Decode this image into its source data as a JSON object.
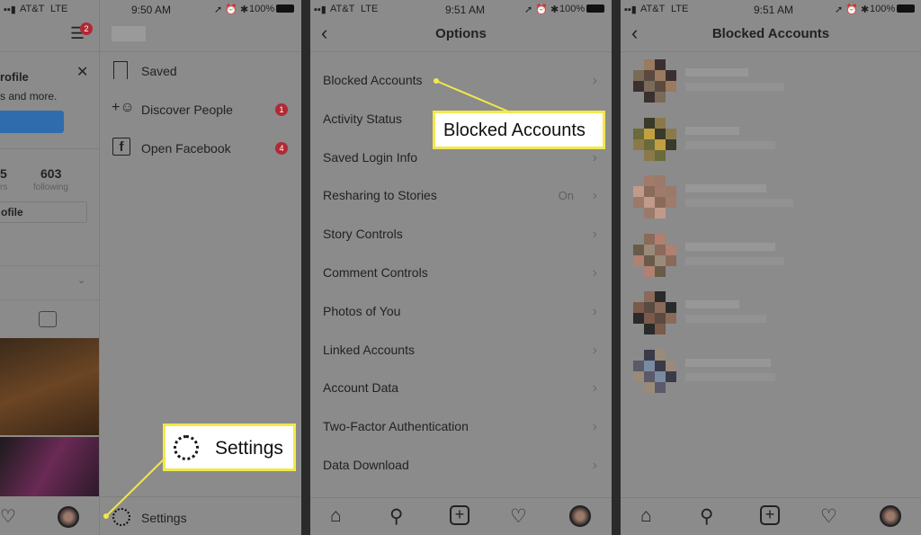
{
  "panel1": {
    "status": {
      "carrier": "AT&T",
      "network": "LTE",
      "time": "9:50 AM",
      "battery": "100%"
    },
    "menu_badge": "2",
    "profile_banner": {
      "title_fragment": "rofile",
      "text_fragment": "s and more."
    },
    "stats": {
      "followers_fragment": "5",
      "followers_label_fragment": "rs",
      "following": "603",
      "following_label": "following"
    },
    "edit_profile_fragment": "ofile",
    "menu_items": [
      {
        "label": "Saved",
        "icon": "bookmark-icon"
      },
      {
        "label": "Discover People",
        "icon": "add-person-icon",
        "badge": "1"
      },
      {
        "label": "Open Facebook",
        "icon": "facebook-icon",
        "badge": "4"
      }
    ],
    "settings_label": "Settings",
    "callout": "Settings"
  },
  "panel2": {
    "status": {
      "carrier": "AT&T",
      "network": "LTE",
      "time": "9:51 AM",
      "battery": "100%"
    },
    "title": "Options",
    "rows": [
      {
        "label": "Blocked Accounts"
      },
      {
        "label": "Activity Status"
      },
      {
        "label": "Saved Login Info"
      },
      {
        "label": "Resharing to Stories",
        "value": "On"
      },
      {
        "label": "Story Controls"
      },
      {
        "label": "Comment Controls"
      },
      {
        "label": "Photos of You"
      },
      {
        "label": "Linked Accounts"
      },
      {
        "label": "Account Data"
      },
      {
        "label": "Two-Factor Authentication"
      },
      {
        "label": "Data Download"
      }
    ],
    "callout": "Blocked Accounts"
  },
  "panel3": {
    "status": {
      "carrier": "AT&T",
      "network": "LTE",
      "time": "9:51 AM",
      "battery": "100%"
    },
    "title": "Blocked Accounts",
    "blocked_count_shown": 6
  },
  "colors": {
    "callout_border": "#f2e84a",
    "badge": "#b02a35",
    "overlay_bg": "#8b8b8b"
  }
}
